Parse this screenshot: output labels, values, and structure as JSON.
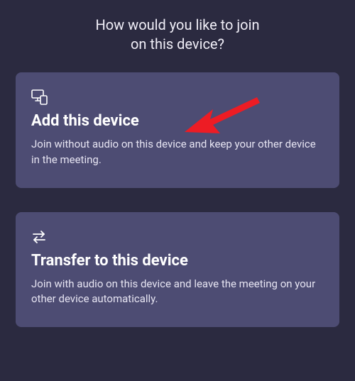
{
  "heading": "How would you like to join\non this device?",
  "options": {
    "add": {
      "title": "Add this device",
      "desc": "Join without audio on this device and keep your other device in the meeting."
    },
    "transfer": {
      "title": "Transfer to this device",
      "desc": "Join with audio on this device and leave the meeting on your other device automatically."
    }
  },
  "annotation": {
    "arrow_color": "#ed1c24"
  }
}
